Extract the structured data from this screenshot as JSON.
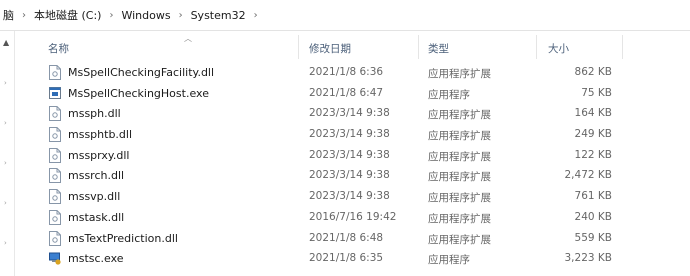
{
  "address": {
    "crumbs": [
      "脑",
      "本地磁盘 (C:)",
      "Windows",
      "System32"
    ],
    "separator": "›"
  },
  "columns": {
    "name": "名称",
    "date": "修改日期",
    "type": "类型",
    "size": "大小"
  },
  "files": [
    {
      "name": "MsSpellCheckingFacility.dll",
      "date": "2021/1/8 6:36",
      "type": "应用程序扩展",
      "size": "862 KB",
      "icon": "dll-file-icon"
    },
    {
      "name": "MsSpellCheckingHost.exe",
      "date": "2021/1/8 6:47",
      "type": "应用程序",
      "size": "75 KB",
      "icon": "exe-app-icon"
    },
    {
      "name": "mssph.dll",
      "date": "2023/3/14 9:38",
      "type": "应用程序扩展",
      "size": "164 KB",
      "icon": "dll-file-icon"
    },
    {
      "name": "mssphtb.dll",
      "date": "2023/3/14 9:38",
      "type": "应用程序扩展",
      "size": "249 KB",
      "icon": "dll-file-icon"
    },
    {
      "name": "mssprxy.dll",
      "date": "2023/3/14 9:38",
      "type": "应用程序扩展",
      "size": "122 KB",
      "icon": "dll-file-icon"
    },
    {
      "name": "mssrch.dll",
      "date": "2023/3/14 9:38",
      "type": "应用程序扩展",
      "size": "2,472 KB",
      "icon": "dll-file-icon"
    },
    {
      "name": "mssvp.dll",
      "date": "2023/3/14 9:38",
      "type": "应用程序扩展",
      "size": "761 KB",
      "icon": "dll-file-icon"
    },
    {
      "name": "mstask.dll",
      "date": "2016/7/16 19:42",
      "type": "应用程序扩展",
      "size": "240 KB",
      "icon": "dll-file-icon"
    },
    {
      "name": "msTextPrediction.dll",
      "date": "2021/1/8 6:48",
      "type": "应用程序扩展",
      "size": "559 KB",
      "icon": "dll-file-icon"
    },
    {
      "name": "mstsc.exe",
      "date": "2021/1/8 6:35",
      "type": "应用程序",
      "size": "3,223 KB",
      "icon": "remote-desktop-icon"
    }
  ]
}
